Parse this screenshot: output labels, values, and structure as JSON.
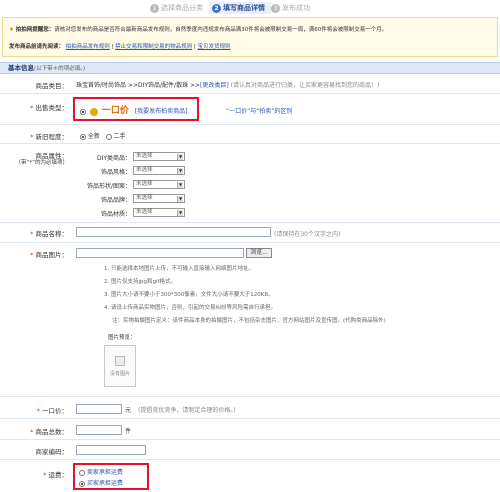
{
  "steps": [
    {
      "num": "1",
      "label": "选择商品分类"
    },
    {
      "num": "2",
      "label": "填写商品详情"
    },
    {
      "num": "3",
      "label": "发布成功"
    }
  ],
  "notice": {
    "line1_title": "拍拍网提醒您：",
    "line1_text": "请核对您发布的商品是否符合最新商品发布规则，自然季度内违规发布商品满30件将会被限制交易一周，满60件将会被限制交易一个月。",
    "line2_title": "发布商品前请先阅读：",
    "line2_links": [
      "拍拍商品发布规则",
      "禁止交易和限制交易的物品规则",
      "宝贝发货规则"
    ]
  },
  "section": {
    "title": "基本信息",
    "hint": "(以下带＊的项必填。)"
  },
  "category": {
    "label": "商品类目：",
    "path": "珠宝首饰/时尚饰品 >>DIY饰品/配件/散珠 >>",
    "change": "[更改类目]",
    "hint": "(请认真对商品进行归类，让买家更容易找到您的商品！)"
  },
  "sale_type": {
    "label": "出售类型：",
    "option": "一口价",
    "auction_link": "[我要发布拍卖商品]",
    "rule_link": "“一口价”与“拍卖”的区别"
  },
  "condition": {
    "label": "新旧程度：",
    "options": [
      "全新",
      "二手"
    ]
  },
  "attrs": {
    "label": "商品属性：",
    "sublabel": "（带“*”的为必填项）",
    "fields": [
      {
        "label": "DIY类商品：",
        "value": "未选择"
      },
      {
        "label": "饰品风格：",
        "value": "未选择"
      },
      {
        "label": "饰品形状/图案：",
        "value": "未选择"
      },
      {
        "label": "饰品品牌：",
        "value": "未选择"
      },
      {
        "label": "饰品材质：",
        "value": "未选择"
      }
    ]
  },
  "name": {
    "label": "商品名称：",
    "hint": "(请保持在30个汉字之内)"
  },
  "image": {
    "label": "商品图片：",
    "browse": "浏览...",
    "notes": [
      "1. 只能选择本地图片上传，不可输入直接输入网络图片地址。",
      "2. 图片仅支持jpg和gif格式。",
      "3. 图片大小请不要小于300*300像素，文件大小请不要大于120KB。",
      "4. 请设上传商品实物图片，否则，引起的交易纠纷等风险需自行承担。",
      "注：实物拍摄图片定义：该件商品本身的拍摄图片，不包括杂志图片、官方网站图片及宣传图。(代购类商品除外)"
    ],
    "preview_label": "图片预览：",
    "no_image": "没有图片"
  },
  "price": {
    "label": "一口价：",
    "unit": "元",
    "hint": "(提倡竞优竞争，请制定合理的价格。)"
  },
  "quantity": {
    "label": "商品总数：",
    "unit": "件"
  },
  "code": {
    "label": "商家编码："
  },
  "shipping": {
    "label": "运费：",
    "options": [
      "卖家承担运费",
      "买家承担运费"
    ]
  }
}
